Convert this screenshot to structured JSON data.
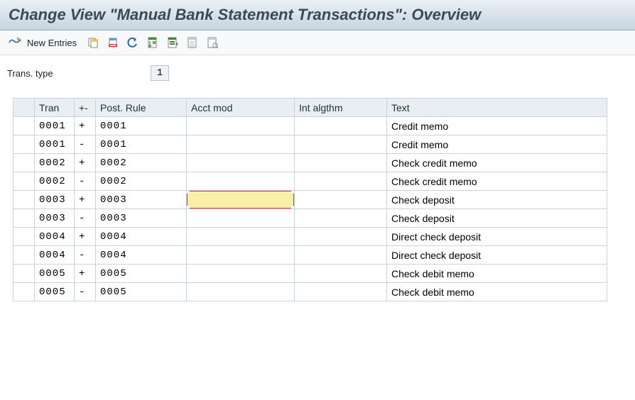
{
  "title": "Change View \"Manual Bank Statement Transactions\": Overview",
  "toolbar": {
    "new_entries_label": "New Entries"
  },
  "filter": {
    "label": "Trans. type",
    "value": "1"
  },
  "columns": {
    "sel": "",
    "tran": "Tran",
    "sign": "+-",
    "rule": "Post. Rule",
    "acct": "Acct mod",
    "alg": "Int algthm",
    "text": "Text"
  },
  "rows": [
    {
      "tran": "0001",
      "sign": "+",
      "rule": "0001",
      "acct": "",
      "alg": "",
      "text": "Credit memo"
    },
    {
      "tran": "0001",
      "sign": "-",
      "rule": "0001",
      "acct": "",
      "alg": "",
      "text": "Credit memo"
    },
    {
      "tran": "0002",
      "sign": "+",
      "rule": "0002",
      "acct": "",
      "alg": "",
      "text": "Check credit memo"
    },
    {
      "tran": "0002",
      "sign": "-",
      "rule": "0002",
      "acct": "",
      "alg": "",
      "text": "Check credit memo"
    },
    {
      "tran": "0003",
      "sign": "+",
      "rule": "0003",
      "acct": "",
      "alg": "",
      "text": "Check deposit",
      "active_col": "acct"
    },
    {
      "tran": "0003",
      "sign": "-",
      "rule": "0003",
      "acct": "",
      "alg": "",
      "text": "Check deposit"
    },
    {
      "tran": "0004",
      "sign": "+",
      "rule": "0004",
      "acct": "",
      "alg": "",
      "text": "Direct check deposit"
    },
    {
      "tran": "0004",
      "sign": "-",
      "rule": "0004",
      "acct": "",
      "alg": "",
      "text": "Direct check deposit"
    },
    {
      "tran": "0005",
      "sign": "+",
      "rule": "0005",
      "acct": "",
      "alg": "",
      "text": "Check debit memo"
    },
    {
      "tran": "0005",
      "sign": "-",
      "rule": "0005",
      "acct": "",
      "alg": "",
      "text": "Check debit memo"
    }
  ]
}
